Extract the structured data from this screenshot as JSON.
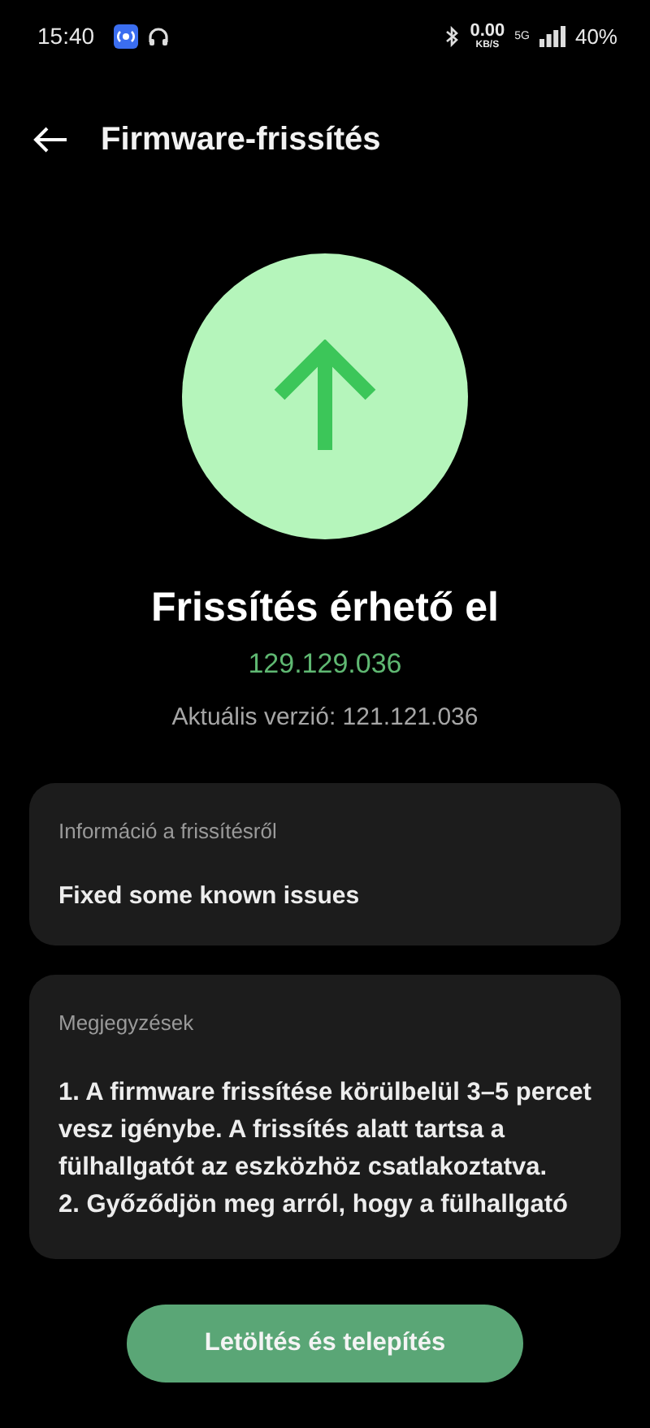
{
  "status_bar": {
    "time": "15:40",
    "speed": "0.00",
    "speed_unit": "KB/S",
    "network": "5G",
    "battery": "40%"
  },
  "header": {
    "title": "Firmware-frissítés"
  },
  "update": {
    "title": "Frissítés érhető el",
    "new_version": "129.129.036",
    "current_version": "Aktuális verzió: 121.121.036"
  },
  "info_card": {
    "heading": "Információ a frissítésről",
    "text": "Fixed some known issues"
  },
  "notes_card": {
    "heading": "Megjegyzések",
    "items": [
      "1. A firmware frissítése körülbelül 3–5 percet vesz igénybe. A frissítés alatt tartsa a fülhallgatót az eszközhöz csatlakoztatva.",
      "2. Győződjön meg arról, hogy a fülhallgató"
    ]
  },
  "button": {
    "label": "Letöltés és telepítés"
  }
}
